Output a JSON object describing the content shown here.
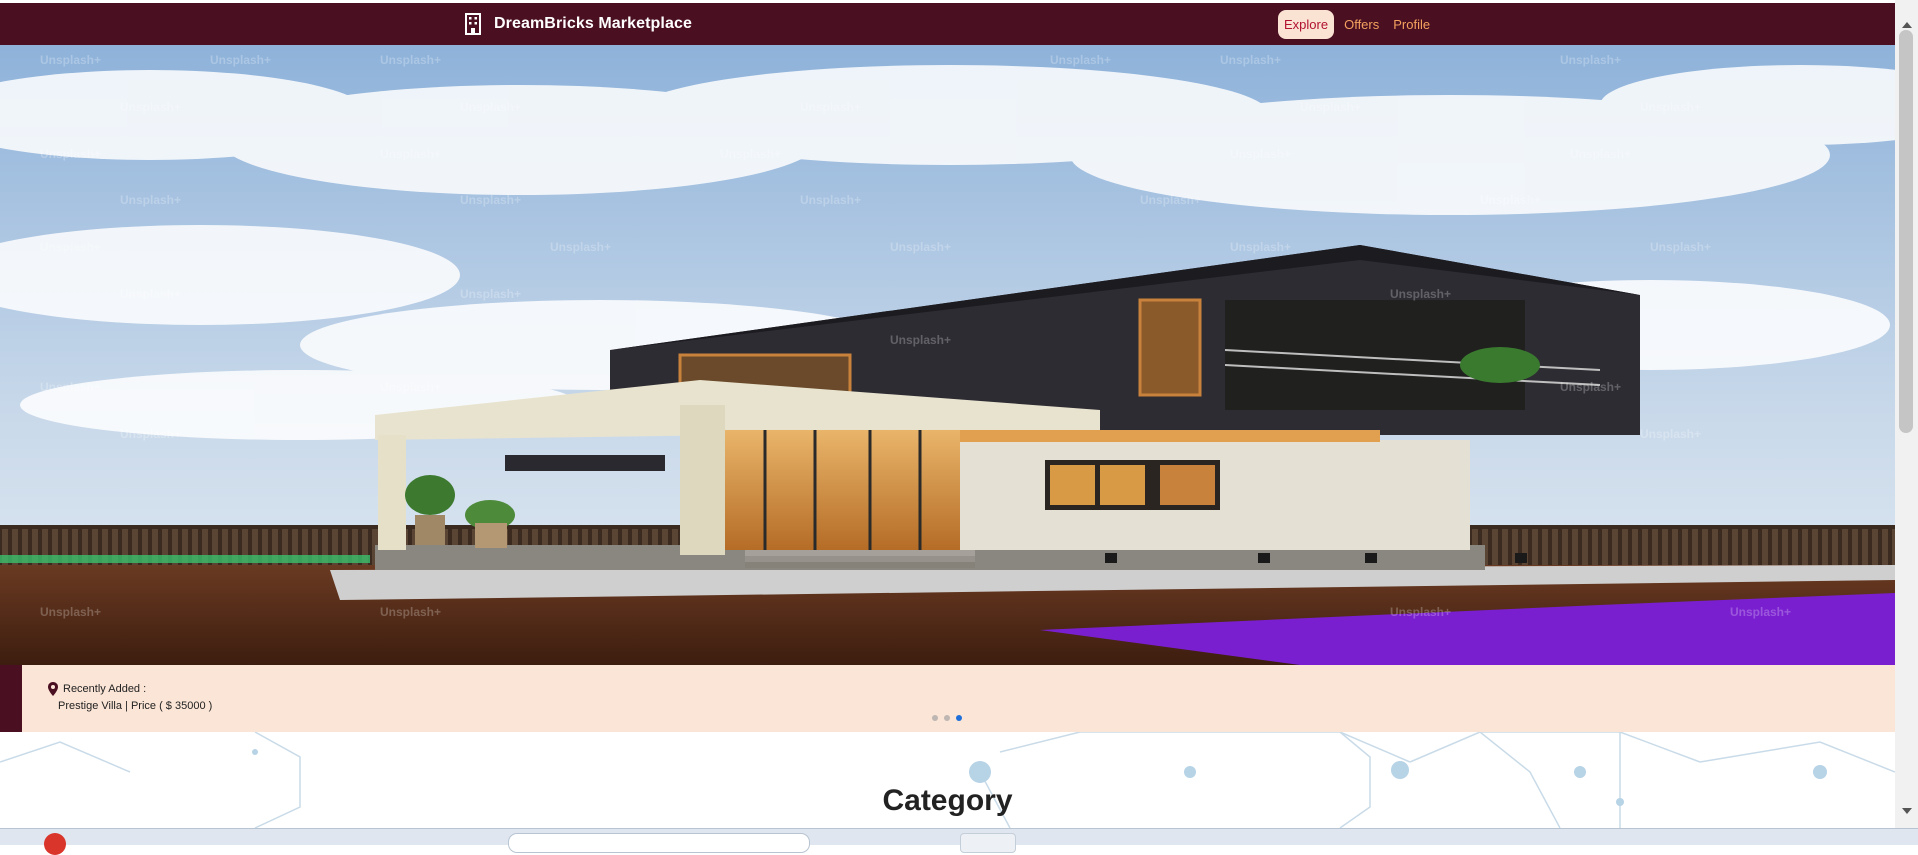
{
  "brand": {
    "name": "DreamBricks Marketplace",
    "icon": "building-icon"
  },
  "nav": {
    "items": [
      {
        "label": "Explore",
        "active": true
      },
      {
        "label": "Offers",
        "active": false
      },
      {
        "label": "Profile",
        "active": false
      }
    ]
  },
  "hero": {
    "watermark": "Unsplash+",
    "image_subject": "modern two-storey villa"
  },
  "carousel": {
    "caption_label": "Recently Added :",
    "caption_detail": "Prestige Villa  | Price ( $ 35000 )",
    "location_icon": "map-pin-icon",
    "slide_count": 3,
    "active_slide": 3
  },
  "category": {
    "title": "Category"
  },
  "colors": {
    "navbar": "#4a0f21",
    "nav_link": "#f3a25f",
    "nav_active_bg": "#fbe3d4",
    "caption_bg": "#fbe5d6",
    "dot_active": "#1e6fd9"
  }
}
